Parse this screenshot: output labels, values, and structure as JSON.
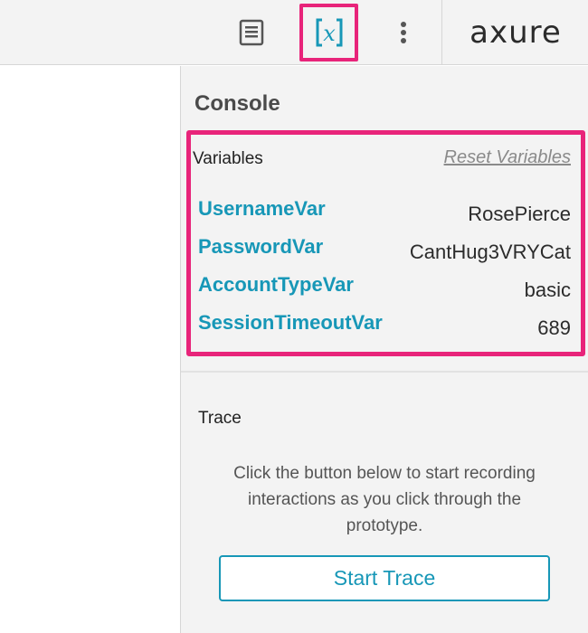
{
  "toolbar": {
    "brand": "axure",
    "icons": [
      "notes-icon",
      "variables-icon",
      "more-vertical-icon"
    ]
  },
  "console": {
    "title": "Console",
    "variables_label": "Variables",
    "reset_label": "Reset Variables",
    "variables": [
      {
        "name": "UsernameVar",
        "value": "RosePierce"
      },
      {
        "name": "PasswordVar",
        "value": "CantHug3VRYCat"
      },
      {
        "name": "AccountTypeVar",
        "value": "basic"
      },
      {
        "name": "SessionTimeoutVar",
        "value": "689"
      }
    ],
    "trace": {
      "label": "Trace",
      "description": "Click the button below to start recording interactions as you click through the prototype.",
      "button_label": "Start Trace"
    }
  },
  "colors": {
    "accent": "#1797b7",
    "highlight": "#e8247a",
    "panel_bg": "#f3f3f3"
  }
}
